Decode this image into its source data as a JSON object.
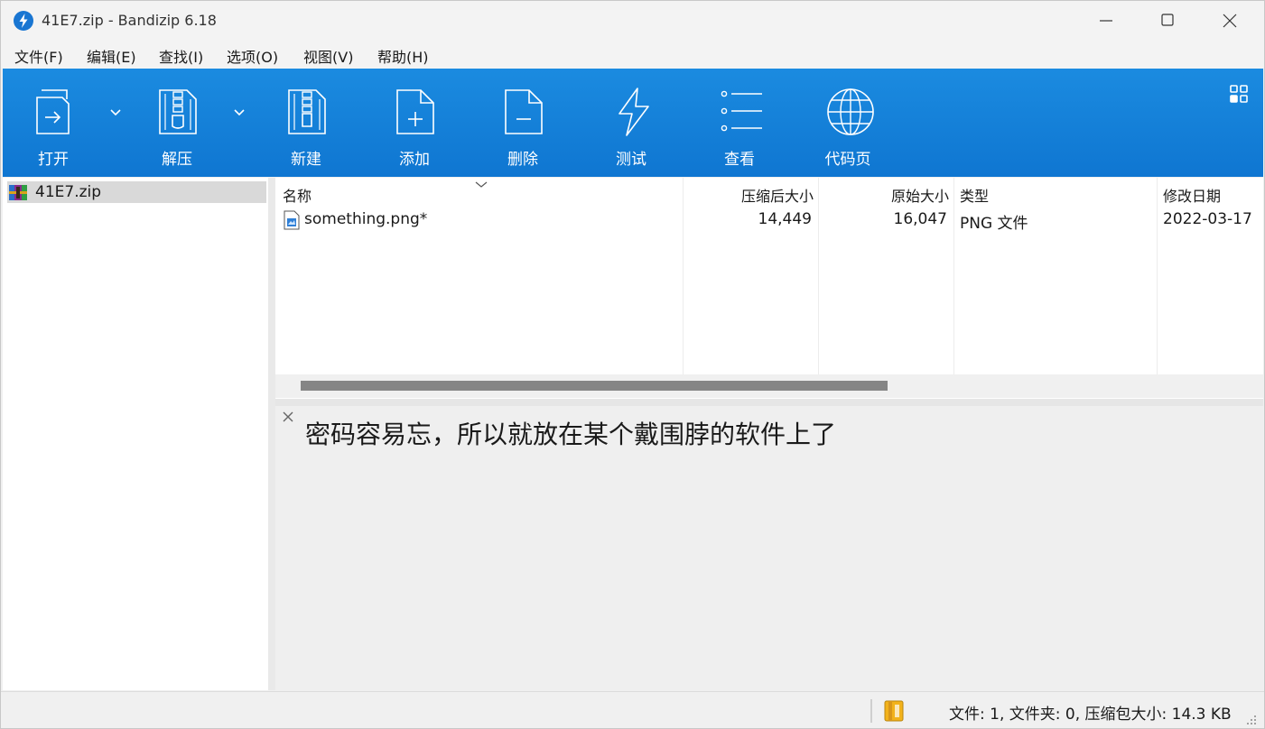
{
  "window": {
    "title": "41E7.zip - Bandizip 6.18",
    "app_icon": "bandizip-bolt-icon",
    "controls": [
      "minimize-icon",
      "maximize-icon",
      "close-icon"
    ]
  },
  "menu": {
    "items": [
      "文件(F)",
      "编辑(E)",
      "查找(I)",
      "选项(O)",
      "视图(V)",
      "帮助(H)"
    ]
  },
  "toolbar": {
    "buttons": [
      {
        "label": "打开",
        "icon": "open-archive-icon",
        "has_dropdown": true
      },
      {
        "label": "解压",
        "icon": "extract-icon",
        "has_dropdown": true
      },
      {
        "label": "新建",
        "icon": "new-archive-icon"
      },
      {
        "label": "添加",
        "icon": "add-file-icon"
      },
      {
        "label": "删除",
        "icon": "delete-file-icon"
      },
      {
        "label": "测试",
        "icon": "test-lightning-icon"
      },
      {
        "label": "查看",
        "icon": "view-list-icon"
      },
      {
        "label": "代码页",
        "icon": "globe-codepage-icon"
      }
    ],
    "layout_toggle_icon": "layout-grid-icon",
    "colors": {
      "background": "#1582d8",
      "foreground": "#ffffff"
    }
  },
  "tree": {
    "items": [
      {
        "label": "41E7.zip",
        "icon": "zip-archive-icon",
        "selected": true
      }
    ]
  },
  "file_list": {
    "columns": [
      "名称",
      "压缩后大小",
      "原始大小",
      "类型",
      "修改日期"
    ],
    "sort_indicator_icon": "chevron-down-icon",
    "rows": [
      {
        "name": "something.png*",
        "compressed": "14,449",
        "original": "16,047",
        "type": "PNG 文件",
        "modified": "2022-03-17",
        "icon": "png-file-icon"
      }
    ]
  },
  "comment": {
    "close_icon": "close-icon",
    "text": "密码容易忘，所以就放在某个戴围脖的软件上了"
  },
  "status": {
    "icon": "archive-info-icon",
    "text": "文件: 1, 文件夹: 0, 压缩包大小: 14.3 KB"
  }
}
